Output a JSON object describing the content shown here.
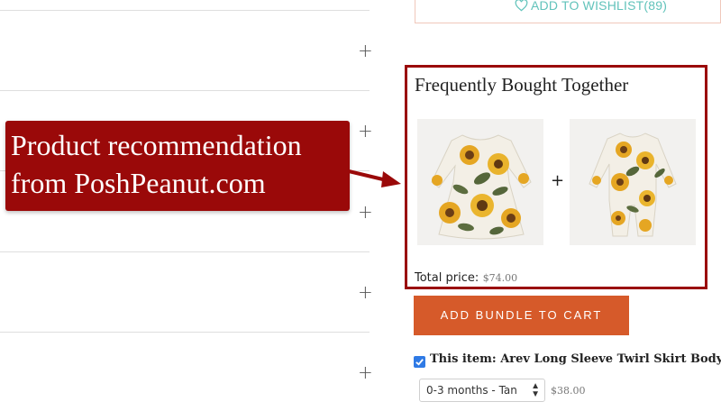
{
  "wishlist": {
    "label": "ADD TO WISHLIST",
    "count": "(89)"
  },
  "accordion": {
    "plus_symbol": "+"
  },
  "fbt": {
    "title": "Frequently Bought Together",
    "plus_symbol": "+",
    "total_label": "Total price:",
    "total_value": "$74.00",
    "products": [
      {
        "name": "Sunflower twirl dress"
      },
      {
        "name": "Sunflower footie"
      }
    ]
  },
  "bundle_button": {
    "label": "ADD BUNDLE TO CART",
    "color": "#d65a2a"
  },
  "item": {
    "label": "This item: Arev Long Sleeve Twirl Skirt Bodysuit",
    "checked": true,
    "size_selected": "0-3 months - Tan",
    "price": "$38.00"
  },
  "callout": {
    "line1": "Product recommendation",
    "line2": "from PoshPeanut.com",
    "color": "#9a0909"
  },
  "colors": {
    "accent_teal": "#62c3bb",
    "callout_red": "#9a0909"
  }
}
